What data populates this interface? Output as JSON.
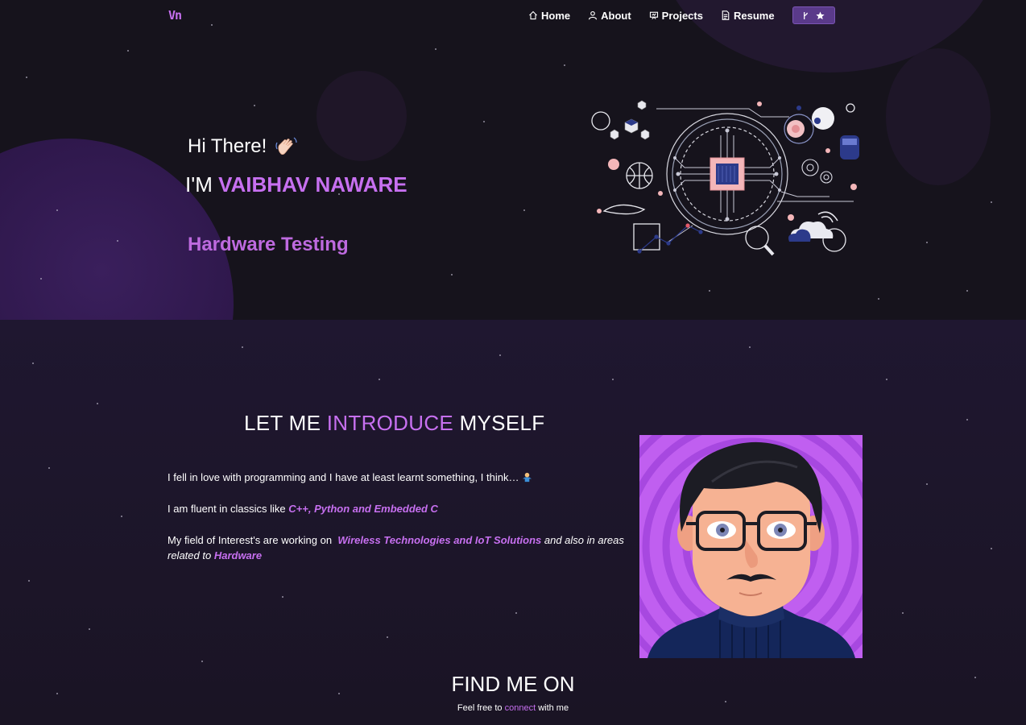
{
  "navbar": {
    "logo": "Vn",
    "links": [
      {
        "label": "Home",
        "icon": "home-icon"
      },
      {
        "label": "About",
        "icon": "user-icon"
      },
      {
        "label": "Projects",
        "icon": "projects-icon"
      },
      {
        "label": "Resume",
        "icon": "document-icon"
      }
    ],
    "fork_button": {
      "icons": [
        "git-fork-icon",
        "star-icon"
      ]
    }
  },
  "hero": {
    "greeting": "Hi There!",
    "name_prefix": "I'M",
    "name": "VAIBHAV NAWARE",
    "role": "Hardware Testing",
    "illustration": "circuit-chip-illustration"
  },
  "about": {
    "title_pre": "LET ME",
    "title_hl": "INTRODUCE",
    "title_post": "MYSELF",
    "p1": "I fell in love with programming and I have at least learnt something, I think…",
    "p2_pre": "I am fluent in classics like",
    "p2_hl": "C++, Python and Embedded C",
    "p3_pre": "My field of Interest's are working on",
    "p3_hl1": "Wireless Technologies and IoT Solutions",
    "p3_mid": "and also in areas related to",
    "p3_hl2": "Hardware"
  },
  "find": {
    "title": "FIND ME ON",
    "sub_pre": "Feel free to",
    "sub_hl": "connect",
    "sub_post": "with me"
  },
  "colors": {
    "accent": "#c770f0",
    "background": "#1a1424",
    "hero_background": "#16131c"
  }
}
